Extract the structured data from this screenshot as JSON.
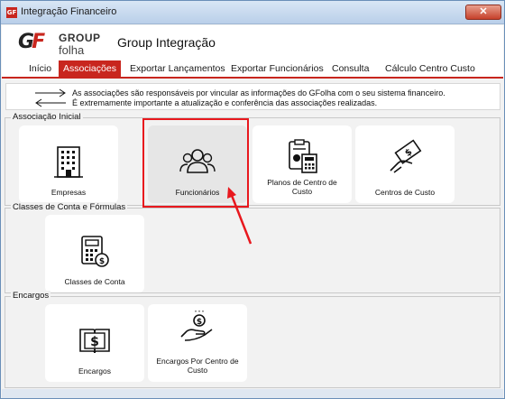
{
  "window": {
    "title": "Integração Financeiro",
    "close_symbol": "✕",
    "app_icon_text": "GF"
  },
  "header": {
    "logo_mark": {
      "g": "G",
      "f": "F"
    },
    "logo_word1": "GROUP",
    "logo_word2": "folha",
    "app_title": "Group Integração"
  },
  "menu": [
    {
      "label": "Início",
      "active": false
    },
    {
      "label": "Associações",
      "active": true
    },
    {
      "label": "Exportar Lançamentos",
      "active": false
    },
    {
      "label": "Exportar Funcionários",
      "active": false
    },
    {
      "label": "Consulta",
      "active": false
    },
    {
      "label": "Cálculo Centro Custo",
      "active": false
    }
  ],
  "info": {
    "line1": "As associações são responsáveis por vincular as informações do GFolha com o seu sistema financeiro.",
    "line2": "É extremamente importante a atualização e conferência das associações realizadas."
  },
  "groups": [
    {
      "label": "Associação Inicial",
      "tiles": [
        {
          "label": "Empresas",
          "icon": "building-icon"
        },
        {
          "label": "Funcionários",
          "icon": "people-icon",
          "selected": true
        },
        {
          "label": "Planos de Centro de Custo",
          "icon": "clipboard-calculator-icon"
        },
        {
          "label": "Centros de Custo",
          "icon": "hand-money-icon"
        }
      ]
    },
    {
      "label": "Classes de Conta e Fórmulas",
      "tiles": [
        {
          "label": "Classes de Conta",
          "icon": "calculator-coin-icon"
        }
      ]
    },
    {
      "label": "Encargos",
      "tiles": [
        {
          "label": "Encargos",
          "icon": "book-dollar-icon"
        },
        {
          "label": "Encargos Por Centro de Custo",
          "icon": "hand-coin-icon"
        }
      ]
    }
  ],
  "colors": {
    "accent_red": "#c8261e",
    "highlight_red": "#e8181e"
  }
}
